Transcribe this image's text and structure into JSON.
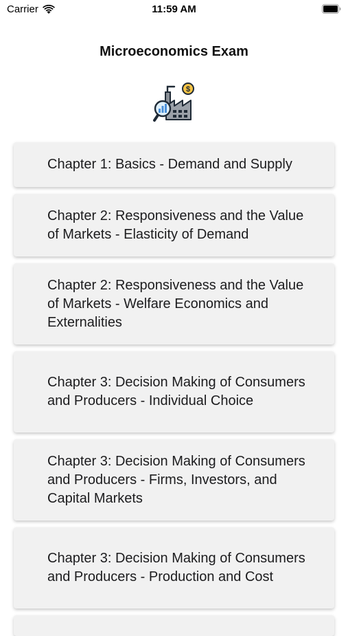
{
  "status_bar": {
    "carrier": "Carrier",
    "time": "11:59 AM",
    "battery_icon": "battery-full-icon",
    "wifi_icon": "wifi-icon"
  },
  "header": {
    "title": "Microeconomics Exam",
    "logo_icon": "factory-economics-icon"
  },
  "chapters": [
    {
      "label": "Chapter 1: Basics - Demand and Supply"
    },
    {
      "label": "Chapter 2: Responsiveness and the Value of Markets - Elasticity of Demand"
    },
    {
      "label": "Chapter 2: Responsiveness and the Value of Markets - Welfare Economics and Externalities"
    },
    {
      "label": "Chapter 3: Decision Making of Consumers and Producers - Individual Choice"
    },
    {
      "label": "Chapter 3: Decision Making of Consumers and Producers - Firms, Investors, and Capital Markets"
    },
    {
      "label": "Chapter 3: Decision Making of Consumers and Producers - Production and Cost"
    }
  ],
  "colors": {
    "card_background": "#f1f1f1",
    "text": "#1c1c1e",
    "logo_accent": "#f6c344",
    "logo_blue": "#4a90d9"
  }
}
